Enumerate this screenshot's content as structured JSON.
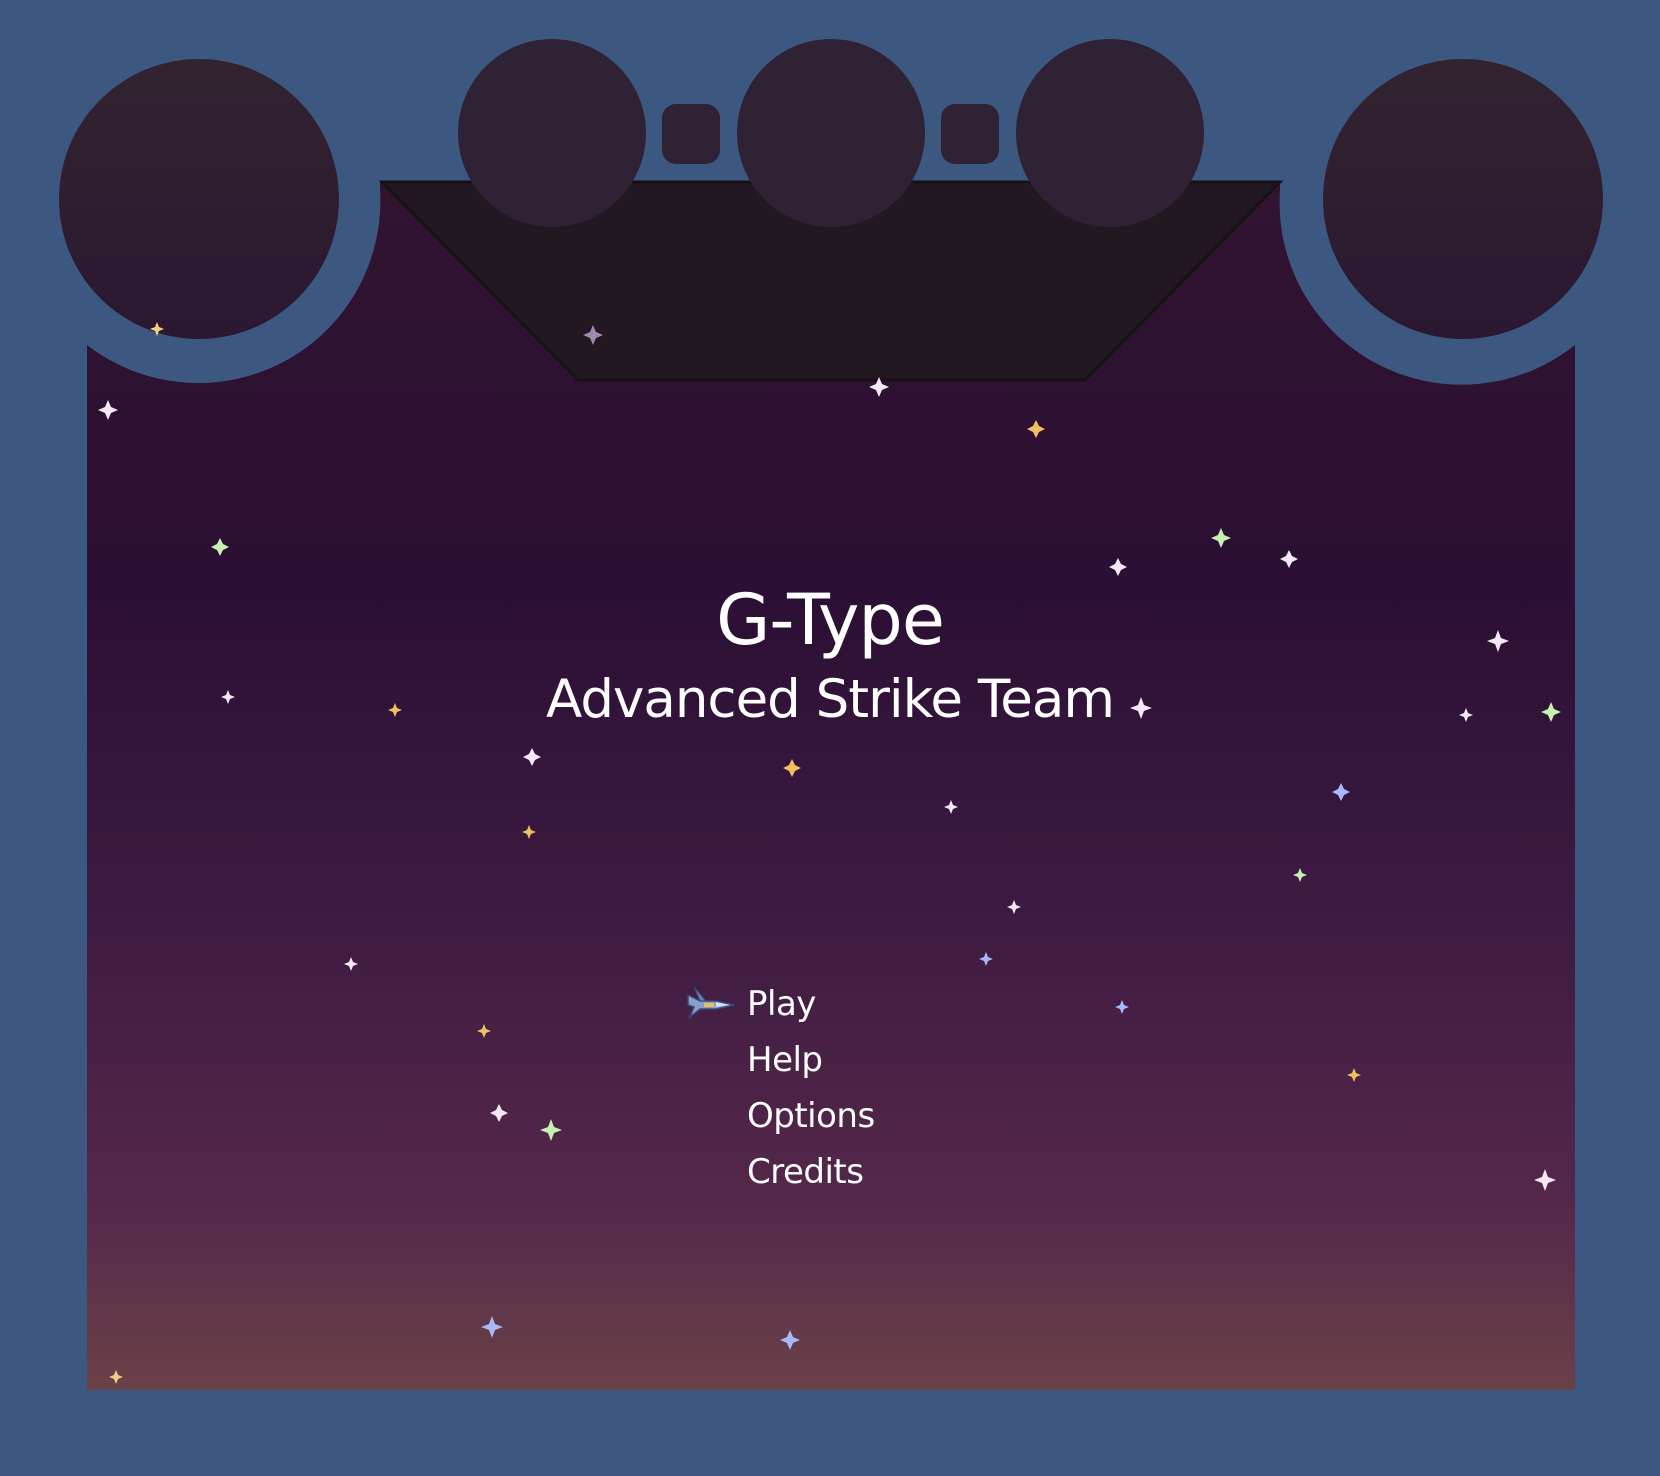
{
  "game": {
    "title": "G-Type",
    "subtitle": "Advanced Strike Team"
  },
  "menu": {
    "items": [
      "Play",
      "Help",
      "Options",
      "Credits"
    ],
    "selected": "Play",
    "cursor_icon": "spaceship-icon"
  },
  "colors": {
    "frame": "#3d5880",
    "sky_top": "#2a0f30",
    "sky_mid": "#3b1840",
    "sky_bottom": "#6a4048",
    "pod": "#2f2234",
    "dock": "#211822",
    "text": "#ffffff"
  }
}
